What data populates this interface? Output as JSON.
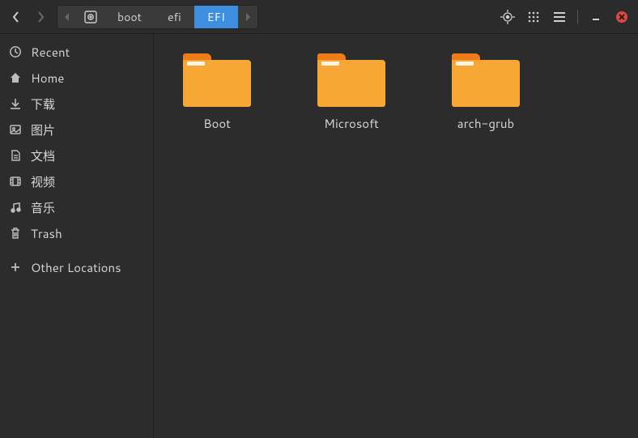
{
  "toolbar": {
    "path_segments": [
      {
        "label": "boot",
        "active": false
      },
      {
        "label": "efi",
        "active": false
      },
      {
        "label": "EFI",
        "active": true
      }
    ]
  },
  "sidebar": {
    "items": [
      {
        "icon": "recent",
        "label": "Recent"
      },
      {
        "icon": "home",
        "label": "Home"
      },
      {
        "icon": "download",
        "label": "下载"
      },
      {
        "icon": "pictures",
        "label": "图片"
      },
      {
        "icon": "document",
        "label": "文档"
      },
      {
        "icon": "video",
        "label": "视频"
      },
      {
        "icon": "music",
        "label": "音乐"
      },
      {
        "icon": "trash",
        "label": "Trash"
      }
    ],
    "other_locations_label": "Other Locations"
  },
  "folders": [
    {
      "name": "Boot"
    },
    {
      "name": "Microsoft"
    },
    {
      "name": "arch-grub"
    }
  ]
}
